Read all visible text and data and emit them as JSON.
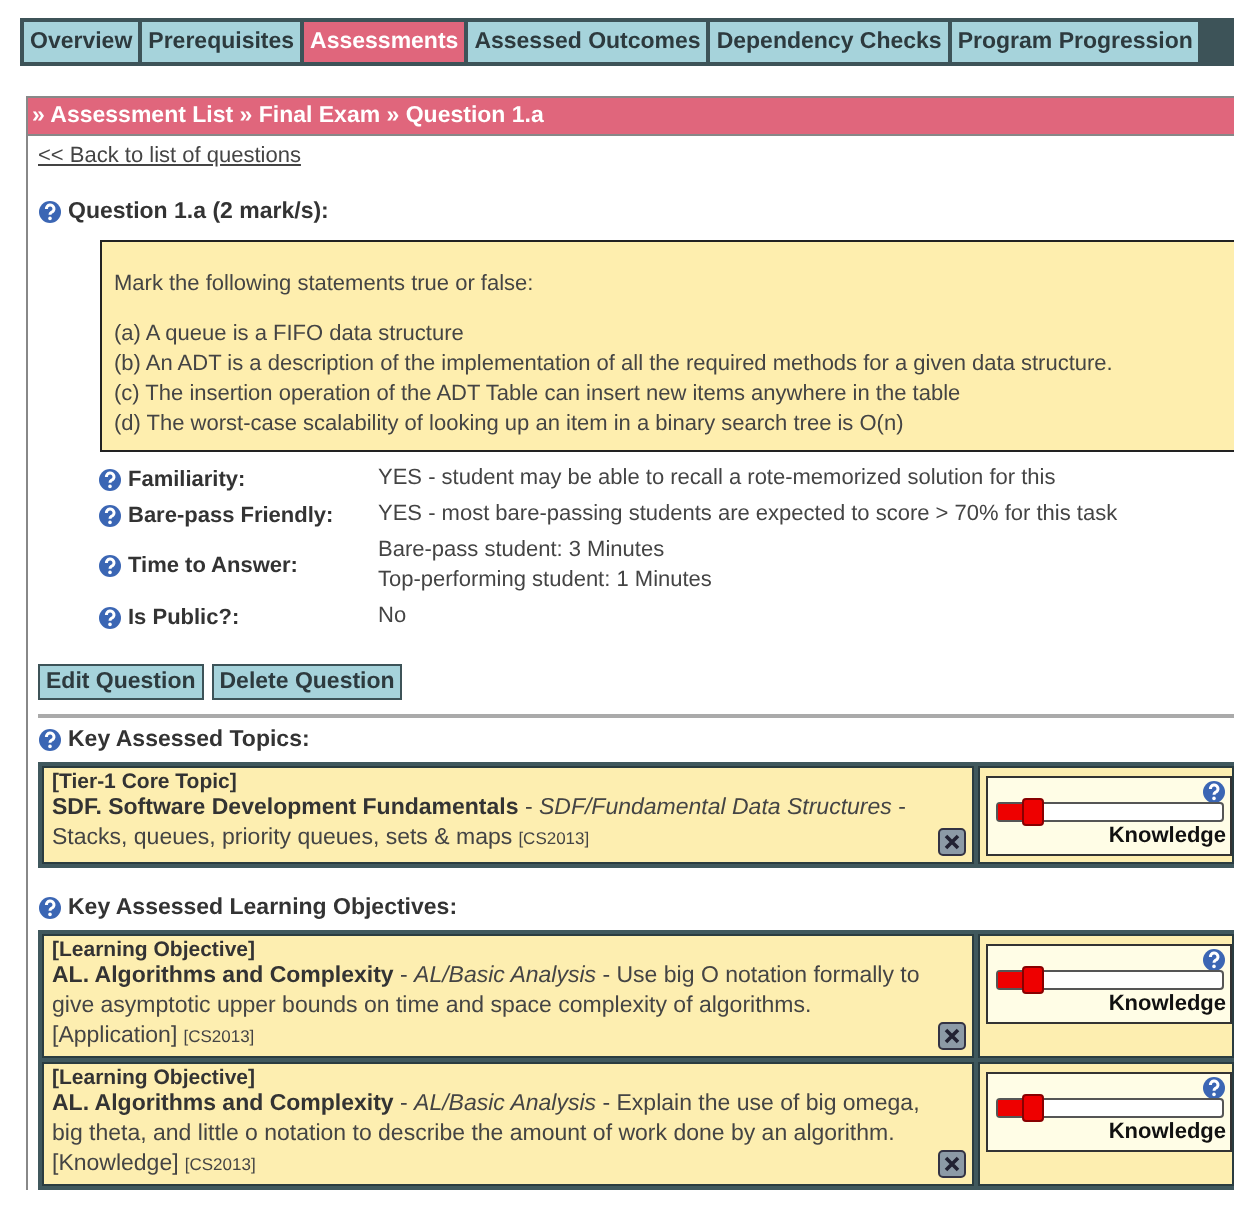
{
  "tabs": [
    {
      "label": "Overview",
      "selected": false
    },
    {
      "label": "Prerequisites",
      "selected": false
    },
    {
      "label": "Assessments",
      "selected": true
    },
    {
      "label": "Assessed Outcomes",
      "selected": false
    },
    {
      "label": "Dependency Checks",
      "selected": false
    },
    {
      "label": "Program Progression",
      "selected": false
    }
  ],
  "breadcrumb": "» Assessment List » Final Exam » Question 1.a",
  "back_link": "<< Back to list of questions",
  "question": {
    "title": "Question 1.a (2 mark/s):",
    "intro": "Mark the following statements true or false:",
    "statements": [
      "(a) A queue is a FIFO data structure",
      "(b) An ADT is a description of the implementation of all the required methods for a given data structure.",
      "(c) The insertion operation of the ADT Table can insert new items anywhere in the table",
      "(d) The worst-case scalability of looking up an item in a binary search tree is O(n)"
    ]
  },
  "attributes": [
    {
      "label": "Familiarity:",
      "values": [
        "YES - student may be able to recall a rote-memorized solution for this"
      ]
    },
    {
      "label": "Bare-pass Friendly:",
      "values": [
        "YES - most bare-passing students are expected to score > 70% for this task"
      ]
    },
    {
      "label": "Time to Answer:",
      "values": [
        "Bare-pass student: 3 Minutes",
        "Top-performing student: 1 Minutes"
      ]
    },
    {
      "label": "Is Public?:",
      "values": [
        "No"
      ]
    }
  ],
  "buttons": [
    "Edit Question",
    "Delete Question"
  ],
  "topics": {
    "heading": "Key Assessed Topics:",
    "items": [
      {
        "tag": "[Tier-1 Core Topic]",
        "text": "**SDF. Software Development Fundamentals** - *SDF/Fundamental Data Structures* - Stacks, queues, priority queues, sets & maps",
        "source": "[CS2013]",
        "level": 0.15,
        "scale": "Knowledge"
      }
    ]
  },
  "objectives": {
    "heading": "Key Assessed Learning Objectives:",
    "items": [
      {
        "tag": "[Learning Objective]",
        "text": "**AL. Algorithms and Complexity** - *AL/Basic Analysis* - Use big O notation formally to give asymptotic upper bounds on time and space complexity of algorithms. [Application]",
        "source": "[CS2013]",
        "level": 0.15,
        "scale": "Knowledge"
      },
      {
        "tag": "[Learning Objective]",
        "text": "**AL. Algorithms and Complexity** - *AL/Basic Analysis* - Explain the use of big omega, big theta, and little o notation to describe the amount of work done by an algorithm. [Knowledge]",
        "source": "[CS2013]",
        "level": 0.15,
        "scale": "Knowledge"
      }
    ]
  }
}
